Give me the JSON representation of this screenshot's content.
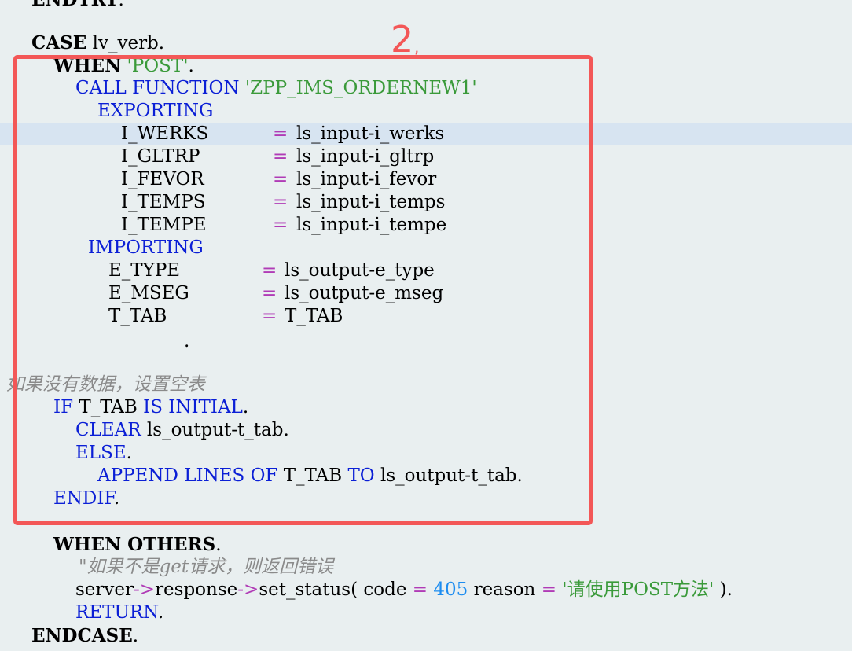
{
  "annotation": {
    "number": "2",
    "comma": ","
  },
  "code": {
    "l0": {
      "kw": "ENDTRY",
      "dot": "."
    },
    "l1": {
      "kw": "CASE",
      "rest": "lv_verb."
    },
    "l2": {
      "kw": "WHEN",
      "str": "'POST'",
      "dot": "."
    },
    "l3": {
      "kw": "CALL FUNCTION",
      "str": "'ZPP_IMS_ORDERNEW1'"
    },
    "l4": {
      "kw": "EXPORTING"
    },
    "l5": {
      "param": "I_WERKS",
      "eq": "=",
      "val": "ls_input-i_werks"
    },
    "l6": {
      "param": "I_GLTRP",
      "eq": "=",
      "val": "ls_input-i_gltrp"
    },
    "l7": {
      "param": "I_FEVOR",
      "eq": "=",
      "val": "ls_input-i_fevor"
    },
    "l8": {
      "param": "I_TEMPS",
      "eq": "=",
      "val": "ls_input-i_temps"
    },
    "l9": {
      "param": "I_TEMPE",
      "eq": "=",
      "val": "ls_input-i_tempe"
    },
    "l10": {
      "kw": "IMPORTING"
    },
    "l11": {
      "param": "E_TYPE",
      "eq": "=",
      "val": "ls_output-e_type"
    },
    "l12": {
      "param": "E_MSEG",
      "eq": "=",
      "val": "ls_output-e_mseg"
    },
    "l13": {
      "param": "T_TAB",
      "eq": "=",
      "val": "T_TAB"
    },
    "l14": {
      "dot": "."
    },
    "l15": {
      "comment": "\" 如果没有数据，设置空表"
    },
    "l16": {
      "kw1": "IF",
      "mid": "T_TAB",
      "kw2": "IS INITIAL",
      "dot": "."
    },
    "l17": {
      "kw": "CLEAR",
      "rest": "ls_output-t_tab."
    },
    "l18": {
      "kw": "ELSE",
      "dot": "."
    },
    "l19": {
      "kw1": "APPEND LINES OF",
      "mid": "T_TAB",
      "kw2": "TO",
      "rest": "ls_output-t_tab."
    },
    "l20": {
      "kw": "ENDIF",
      "dot": "."
    },
    "l21": {
      "kw": "WHEN OTHERS",
      "dot": "."
    },
    "l22": {
      "comment": "\"如果不是get请求，则返回错误"
    },
    "l23": {
      "a": "server",
      "arrow": "->",
      "b": "response",
      "c": "set_status( code",
      "eq": "=",
      "num": "405",
      "d": "reason",
      "str": "'请使用POST方法'",
      "e": ")."
    },
    "l24": {
      "kw": "RETURN",
      "dot": "."
    },
    "l25": {
      "kw": "ENDCASE",
      "dot": "."
    }
  }
}
